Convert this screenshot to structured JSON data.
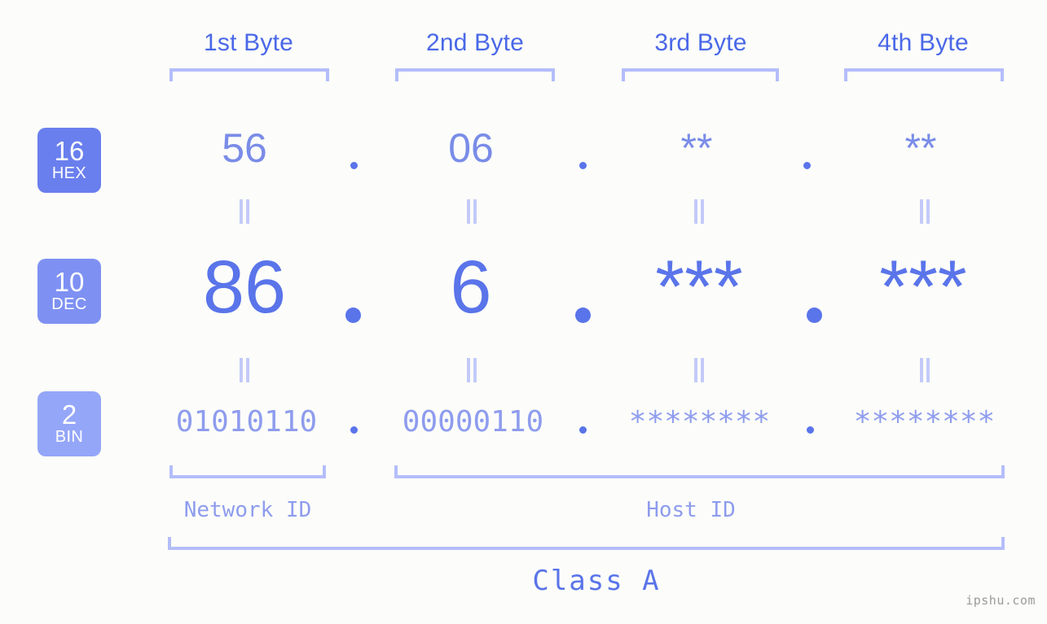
{
  "headers": [
    {
      "label": "1st Byte"
    },
    {
      "label": "2nd Byte"
    },
    {
      "label": "3rd Byte"
    },
    {
      "label": "4th Byte"
    }
  ],
  "bases": [
    {
      "num": "16",
      "label": "HEX",
      "color": "#6a7fee"
    },
    {
      "num": "10",
      "label": "DEC",
      "color": "#7e91f3"
    },
    {
      "num": "2",
      "label": "BIN",
      "color": "#94a6f8"
    }
  ],
  "rows": {
    "hex": {
      "values": [
        "56",
        "06",
        "**",
        "**"
      ]
    },
    "dec": {
      "values": [
        "86",
        "6",
        "***",
        "***"
      ]
    },
    "bin": {
      "values": [
        "01010110",
        "00000110",
        "********",
        "********"
      ]
    }
  },
  "separator": ".",
  "equals_glyph": "||",
  "segments": {
    "network_id": "Network ID",
    "host_id": "Host ID",
    "class": "Class A"
  },
  "watermark": "ipshu.com",
  "colors": {
    "background": "#fcfdfa",
    "header_text": "#4a68e8",
    "hex_value": "#7a8ce8",
    "dec_value": "#5a74ea",
    "bin_value": "#8e9cee",
    "bracket": "#b4bdfa",
    "equals": "#c3caf9",
    "watermark": "#9a9a9a"
  }
}
